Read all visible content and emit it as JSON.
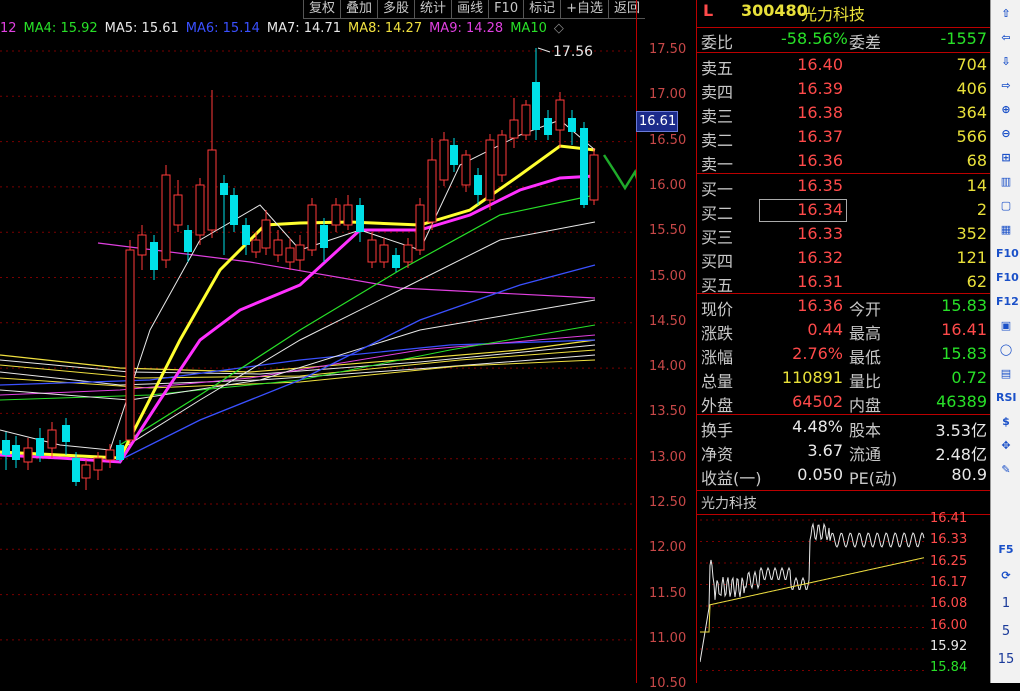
{
  "toolbar": {
    "items": [
      "复权",
      "叠加",
      "多股",
      "统计",
      "画线",
      "F10",
      "标记",
      "+自选",
      "返回"
    ]
  },
  "ma_legend": [
    {
      "text": "12",
      "color": "#e040e0"
    },
    {
      "text": "MA4: 15.92",
      "color": "#28e028"
    },
    {
      "text": "MA5: 15.61",
      "color": "#e8e8e8"
    },
    {
      "text": "MA6: 15.14",
      "color": "#3a50ff"
    },
    {
      "text": "MA7: 14.71",
      "color": "#e8e8e8"
    },
    {
      "text": "MA8: 14.27",
      "color": "#f0e040"
    },
    {
      "text": "MA9: 14.28",
      "color": "#e040e0"
    },
    {
      "text": "MA10",
      "color": "#28e028"
    }
  ],
  "chart": {
    "high_label": "17.56",
    "current_price": "16.61",
    "y_ticks": [
      "17.50",
      "17.00",
      "16.50",
      "16.00",
      "15.50",
      "15.00",
      "14.50",
      "14.00",
      "13.50",
      "13.00",
      "12.50",
      "12.00",
      "11.50",
      "11.00",
      "10.50"
    ]
  },
  "quote": {
    "mark": "L",
    "code": "300480",
    "name": "光力科技",
    "weibi_label": "委比",
    "weibi_value": "-58.56%",
    "weicha_label": "委差",
    "weicha_value": "-1557",
    "asks": [
      {
        "label": "卖五",
        "price": "16.40",
        "vol": "704"
      },
      {
        "label": "卖四",
        "price": "16.39",
        "vol": "406"
      },
      {
        "label": "卖三",
        "price": "16.38",
        "vol": "364"
      },
      {
        "label": "卖二",
        "price": "16.37",
        "vol": "566"
      },
      {
        "label": "卖一",
        "price": "16.36",
        "vol": "68"
      }
    ],
    "bids": [
      {
        "label": "买一",
        "price": "16.35",
        "vol": "14"
      },
      {
        "label": "买二",
        "price": "16.34",
        "vol": "2"
      },
      {
        "label": "买三",
        "price": "16.33",
        "vol": "352"
      },
      {
        "label": "买四",
        "price": "16.32",
        "vol": "121"
      },
      {
        "label": "买五",
        "price": "16.31",
        "vol": "62"
      }
    ],
    "stats": [
      {
        "l1": "现价",
        "v1": "16.36",
        "c1": "red",
        "l2": "今开",
        "v2": "15.83",
        "c2": "green"
      },
      {
        "l1": "涨跌",
        "v1": "0.44",
        "c1": "red",
        "l2": "最高",
        "v2": "16.41",
        "c2": "red"
      },
      {
        "l1": "涨幅",
        "v1": "2.76%",
        "c1": "red",
        "l2": "最低",
        "v2": "15.83",
        "c2": "green"
      },
      {
        "l1": "总量",
        "v1": "110891",
        "c1": "yellow",
        "l2": "量比",
        "v2": "0.72",
        "c2": "green"
      },
      {
        "l1": "外盘",
        "v1": "64502",
        "c1": "red",
        "l2": "内盘",
        "v2": "46389",
        "c2": "green"
      }
    ],
    "stats2": [
      {
        "l1": "换手",
        "v1": "4.48%",
        "l2": "股本",
        "v2": "3.53亿"
      },
      {
        "l1": "净资",
        "v1": "3.67",
        "l2": "流通",
        "v2": "2.48亿"
      },
      {
        "l1": "收益(一)",
        "v1": "0.050",
        "l2": "PE(动)",
        "v2": "80.9"
      }
    ],
    "mini_title": "光力科技",
    "mini_ticks": [
      {
        "v": "16.41",
        "c": "#ff4a4a"
      },
      {
        "v": "16.33",
        "c": "#ff4a4a"
      },
      {
        "v": "16.25",
        "c": "#ff4a4a"
      },
      {
        "v": "16.17",
        "c": "#ff4a4a"
      },
      {
        "v": "16.08",
        "c": "#ff4a4a"
      },
      {
        "v": "16.00",
        "c": "#ff4a4a"
      },
      {
        "v": "15.92",
        "c": "#e8e8e8"
      },
      {
        "v": "15.84",
        "c": "#28e028"
      }
    ]
  },
  "toolstrip": {
    "icons": [
      "arrow-up-icon",
      "arrow-left-icon",
      "arrow-down-icon",
      "arrow-right-icon",
      "zoom-in-icon",
      "zoom-out-icon",
      "kline-icon",
      "bar-chart-icon",
      "window-icon",
      "grid-icon",
      "f10-icon",
      "f9-icon",
      "fullscreen-icon",
      "history-icon",
      "circle-icon",
      "trend-icon",
      "rsi-icon",
      "dollar-icon",
      "move-icon",
      "pen-icon",
      "f5-icon",
      "refresh-icon"
    ],
    "icon_texts": [
      "⇧",
      "⇦",
      "⇩",
      "⇨",
      "⊕",
      "⊖",
      "⊞",
      "▥",
      "▢",
      "▦",
      "F10",
      "F10",
      "F12",
      "▣",
      "◯",
      "▤",
      "RSI",
      "$",
      "✥",
      "✎",
      "F5",
      "⟳"
    ],
    "numbers": [
      "1",
      "5",
      "15"
    ]
  }
}
